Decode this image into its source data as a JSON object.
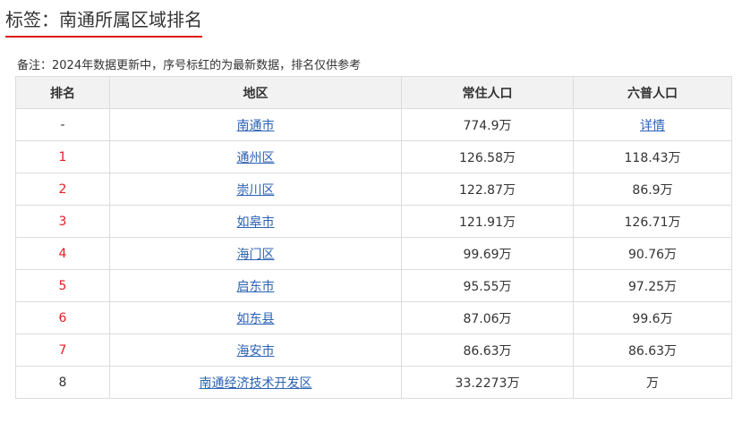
{
  "title": "标签：南通所属区域排名",
  "note": "备注：2024年数据更新中，序号标红的为最新数据，排名仅供参考",
  "colors": {
    "accent_underline": "#d9161c",
    "rank_red": "#e51c23",
    "link": "#2b62b5",
    "header_bg": "#f2f2f2",
    "border": "#dcdcdc"
  },
  "table": {
    "headers": {
      "rank": "排名",
      "region": "地区",
      "resident_pop": "常住人口",
      "census6": "六普人口"
    },
    "rows": [
      {
        "rank": "-",
        "rank_red": false,
        "region": "南通市",
        "resident_pop": "774.9万",
        "census6": "详情",
        "census6_link": true
      },
      {
        "rank": "1",
        "rank_red": true,
        "region": "通州区",
        "resident_pop": "126.58万",
        "census6": "118.43万",
        "census6_link": false
      },
      {
        "rank": "2",
        "rank_red": true,
        "region": "崇川区",
        "resident_pop": "122.87万",
        "census6": "86.9万",
        "census6_link": false
      },
      {
        "rank": "3",
        "rank_red": true,
        "region": "如皋市",
        "resident_pop": "121.91万",
        "census6": "126.71万",
        "census6_link": false
      },
      {
        "rank": "4",
        "rank_red": true,
        "region": "海门区",
        "resident_pop": "99.69万",
        "census6": "90.76万",
        "census6_link": false
      },
      {
        "rank": "5",
        "rank_red": true,
        "region": "启东市",
        "resident_pop": "95.55万",
        "census6": "97.25万",
        "census6_link": false
      },
      {
        "rank": "6",
        "rank_red": true,
        "region": "如东县",
        "resident_pop": "87.06万",
        "census6": "99.6万",
        "census6_link": false
      },
      {
        "rank": "7",
        "rank_red": true,
        "region": "海安市",
        "resident_pop": "86.63万",
        "census6": "86.63万",
        "census6_link": false
      },
      {
        "rank": "8",
        "rank_red": false,
        "region": "南通经济技术开发区",
        "resident_pop": "33.2273万",
        "census6": "万",
        "census6_link": false
      }
    ]
  }
}
